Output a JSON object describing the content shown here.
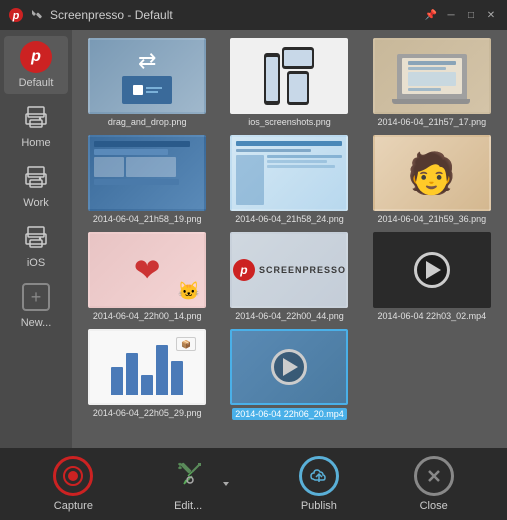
{
  "window": {
    "title": "Screenpresso  -  Default",
    "pin_icon": "pin",
    "minimize_icon": "minus",
    "maximize_icon": "square",
    "close_icon": "x"
  },
  "sidebar": {
    "items": [
      {
        "id": "default",
        "label": "Default",
        "icon": "screenpresso-p",
        "active": true
      },
      {
        "id": "home",
        "label": "Home",
        "icon": "printer"
      },
      {
        "id": "work",
        "label": "Work",
        "icon": "printer"
      },
      {
        "id": "ios",
        "label": "iOS",
        "icon": "printer"
      },
      {
        "id": "new",
        "label": "New...",
        "icon": "plus"
      }
    ]
  },
  "thumbnails": [
    {
      "id": "t1",
      "label": "drag_and_drop.png",
      "type": "dnd",
      "selected": false
    },
    {
      "id": "t2",
      "label": "ios_screenshots.png",
      "type": "ios",
      "selected": false
    },
    {
      "id": "t3",
      "label": "2014-06-04_21h57_17.png",
      "type": "laptop",
      "selected": false
    },
    {
      "id": "t4",
      "label": "2014-06-04_21h58_19.png",
      "type": "screen-blue",
      "selected": false
    },
    {
      "id": "t5",
      "label": "2014-06-04_21h58_24.png",
      "type": "screen-light",
      "selected": false
    },
    {
      "id": "t6",
      "label": "2014-06-04_21h59_36.png",
      "type": "photo",
      "selected": false
    },
    {
      "id": "t7",
      "label": "2014-06-04_22h00_14.png",
      "type": "heart",
      "selected": false
    },
    {
      "id": "t8",
      "label": "2014-06-04_22h00_44.png",
      "type": "screenpresso-logo",
      "selected": false
    },
    {
      "id": "t9",
      "label": "2014-06-04 22h03_02.mp4",
      "type": "video",
      "selected": false
    },
    {
      "id": "t10",
      "label": "2014-06-04_22h05_29.png",
      "type": "chart",
      "selected": false
    },
    {
      "id": "t11",
      "label": "2014-06-04 22h06_20.mp4",
      "type": "video2",
      "selected": true
    }
  ],
  "toolbar": {
    "capture_label": "Capture",
    "edit_label": "Edit...",
    "publish_label": "Publish",
    "close_label": "Close"
  }
}
